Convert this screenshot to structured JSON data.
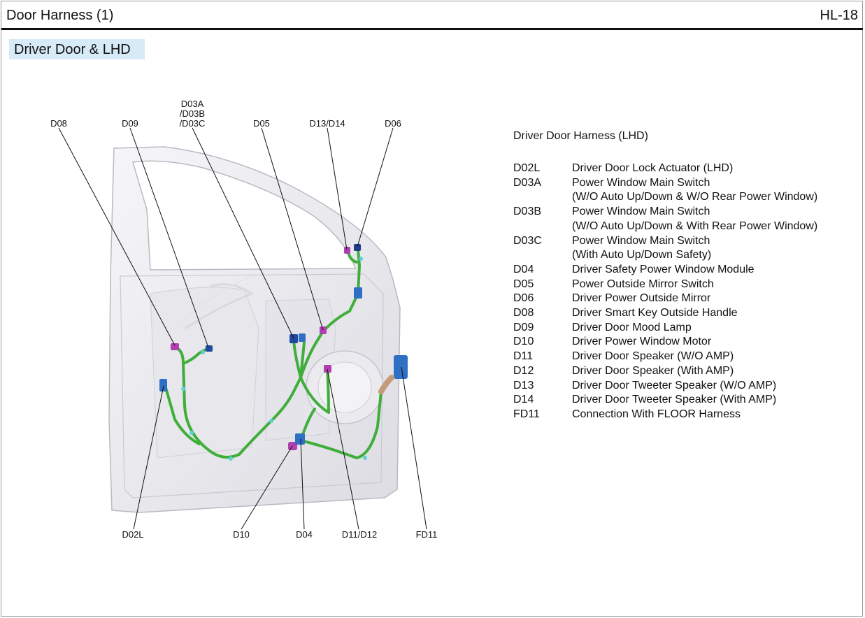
{
  "header": {
    "title": "Door Harness (1)",
    "code": "HL-18"
  },
  "section": {
    "title": "Driver Door & LHD"
  },
  "callouts": {
    "d08": "D08",
    "d09": "D09",
    "d03_line1": "D03A",
    "d03_line2": "/D03B",
    "d03_line3": "/D03C",
    "d05": "D05",
    "d13_d14": "D13/D14",
    "d06": "D06",
    "d02l": "D02L",
    "d10": "D10",
    "d04": "D04",
    "d11_d12": "D11/D12",
    "fd11": "FD11"
  },
  "legend": {
    "title": "Driver Door Harness (LHD)",
    "items": [
      {
        "code": "D02L",
        "desc": "Driver Door Lock Actuator (LHD)"
      },
      {
        "code": "D03A",
        "desc": "Power Window Main Switch\n(W/O Auto Up/Down & W/O Rear Power Window)"
      },
      {
        "code": "D03B",
        "desc": "Power Window Main Switch\n(W/O Auto Up/Down & With Rear Power Window)"
      },
      {
        "code": "D03C",
        "desc": "Power Window Main Switch\n(With Auto Up/Down Safety)"
      },
      {
        "code": "D04",
        "desc": "Driver Safety Power Window Module"
      },
      {
        "code": "D05",
        "desc": "Power Outside Mirror Switch"
      },
      {
        "code": "D06",
        "desc": "Driver Power Outside Mirror"
      },
      {
        "code": "D08",
        "desc": "Driver Smart Key Outside Handle"
      },
      {
        "code": "D09",
        "desc": "Driver Door Mood Lamp"
      },
      {
        "code": "D10",
        "desc": "Driver Power Window Motor"
      },
      {
        "code": "D11",
        "desc": "Driver Door Speaker (W/O AMP)"
      },
      {
        "code": "D12",
        "desc": "Driver Door Speaker (With AMP)"
      },
      {
        "code": "D13",
        "desc": "Driver Door Tweeter Speaker (W/O AMP)"
      },
      {
        "code": "D14",
        "desc": "Driver Door Tweeter Speaker (With AMP)"
      },
      {
        "code": "FD11",
        "desc": "Connection With FLOOR Harness"
      }
    ]
  },
  "colors": {
    "harness": "#3fae3a",
    "connector_blue": "#2f6fc4",
    "connector_magenta": "#b03fb0",
    "clip_cyan": "#5fd0d6",
    "door_panel": "#eeeef2",
    "section_fill": "#d7eaf7"
  }
}
